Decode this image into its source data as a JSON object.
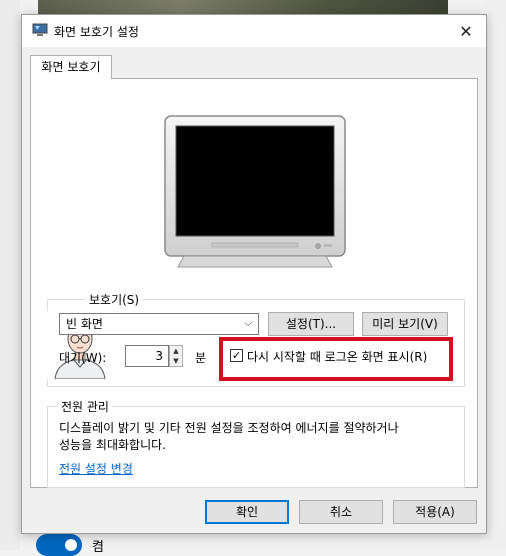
{
  "window": {
    "title": "화면 보호기 설정",
    "close_glyph": "✕"
  },
  "tab": {
    "label": "화면 보호기"
  },
  "screensaver": {
    "group_label": "화면 보호기(S)",
    "group_label_visible": "보호기(S)",
    "selected": "빈 화면",
    "settings_button": "설정(T)...",
    "preview_button": "미리 보기(V)",
    "wait_label": "대기(W):",
    "wait_value": "3",
    "wait_unit": "분",
    "resume_checkbox_label": "다시 시작할 때 로그온 화면 표시(R)",
    "resume_checked": true,
    "check_glyph": "✓",
    "highlight_color": "#d0101e"
  },
  "power": {
    "group_label": "전원 관리",
    "desc_line1": "디스플레이 밝기 및 기타 전원 설정을 조정하여 에너지를 절약하거나",
    "desc_line2": "성능을 최대화합니다.",
    "link": "전원 설정 변경"
  },
  "footer": {
    "ok": "확인",
    "cancel": "취소",
    "apply": "적용(A)"
  },
  "background": {
    "toggle_label": "켬"
  },
  "colors": {
    "accent": "#0078d7",
    "link": "#0066cc"
  },
  "icons": [
    "monitor-icon",
    "close-icon",
    "chevron-down-icon",
    "spin-up-icon",
    "spin-down-icon",
    "checkbox-check-icon",
    "avatar-illustration"
  ]
}
